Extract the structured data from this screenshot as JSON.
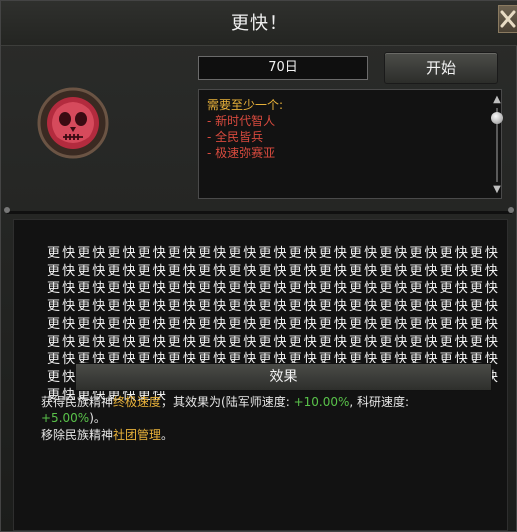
{
  "window": {
    "title": "更快！",
    "close_icon": "close-x-icon"
  },
  "controls": {
    "days_value": "70日",
    "start_label": "开始"
  },
  "requirements": {
    "header": "需要至少一个:",
    "items": [
      "- 新时代智人",
      "- 全民皆兵",
      "- 极速弥赛亚"
    ]
  },
  "description": {
    "text": "更快更快更快更快更快更快更快更快更快更快更快更快更快更快更快更快更快更快更快更快更快更快更快更快更快更快更快更快更快更快更快更快更快更快更快更快更快更快更快更快更快更快更快更快更快更快更快更快更快更快更快更快更快更快更快更快更快更快更快更快更快更快更快更快更快更快更快更快更快更快更快更快更快更快更快更快更快更快更快更快更快更快更快更快更快更快更快更快更快更快更快更快更快更快更快更快更快更快更快更快更快更快更快更快更快更快更快更快更快更快更快更快更快更快更快更快更快更快更快更快更快更快更快更快"
  },
  "effects": {
    "header": "效果",
    "line1_prefix": "获得民族精神",
    "line1_spirit": "终极速度",
    "line1_mid": "，其效果为(陆军师速度: ",
    "line1_value1": "+10.00%",
    "line1_mid2": ", 科研速度:",
    "line2_value": "+5.00%",
    "line2_suffix": ")。",
    "line3_prefix": "移除民族精神",
    "line3_spirit": "社团管理",
    "line3_suffix": "。"
  },
  "colors": {
    "highlight_yellow": "#e8b13a",
    "requirement_red": "#d84a3e",
    "bonus_green": "#59c24a"
  }
}
